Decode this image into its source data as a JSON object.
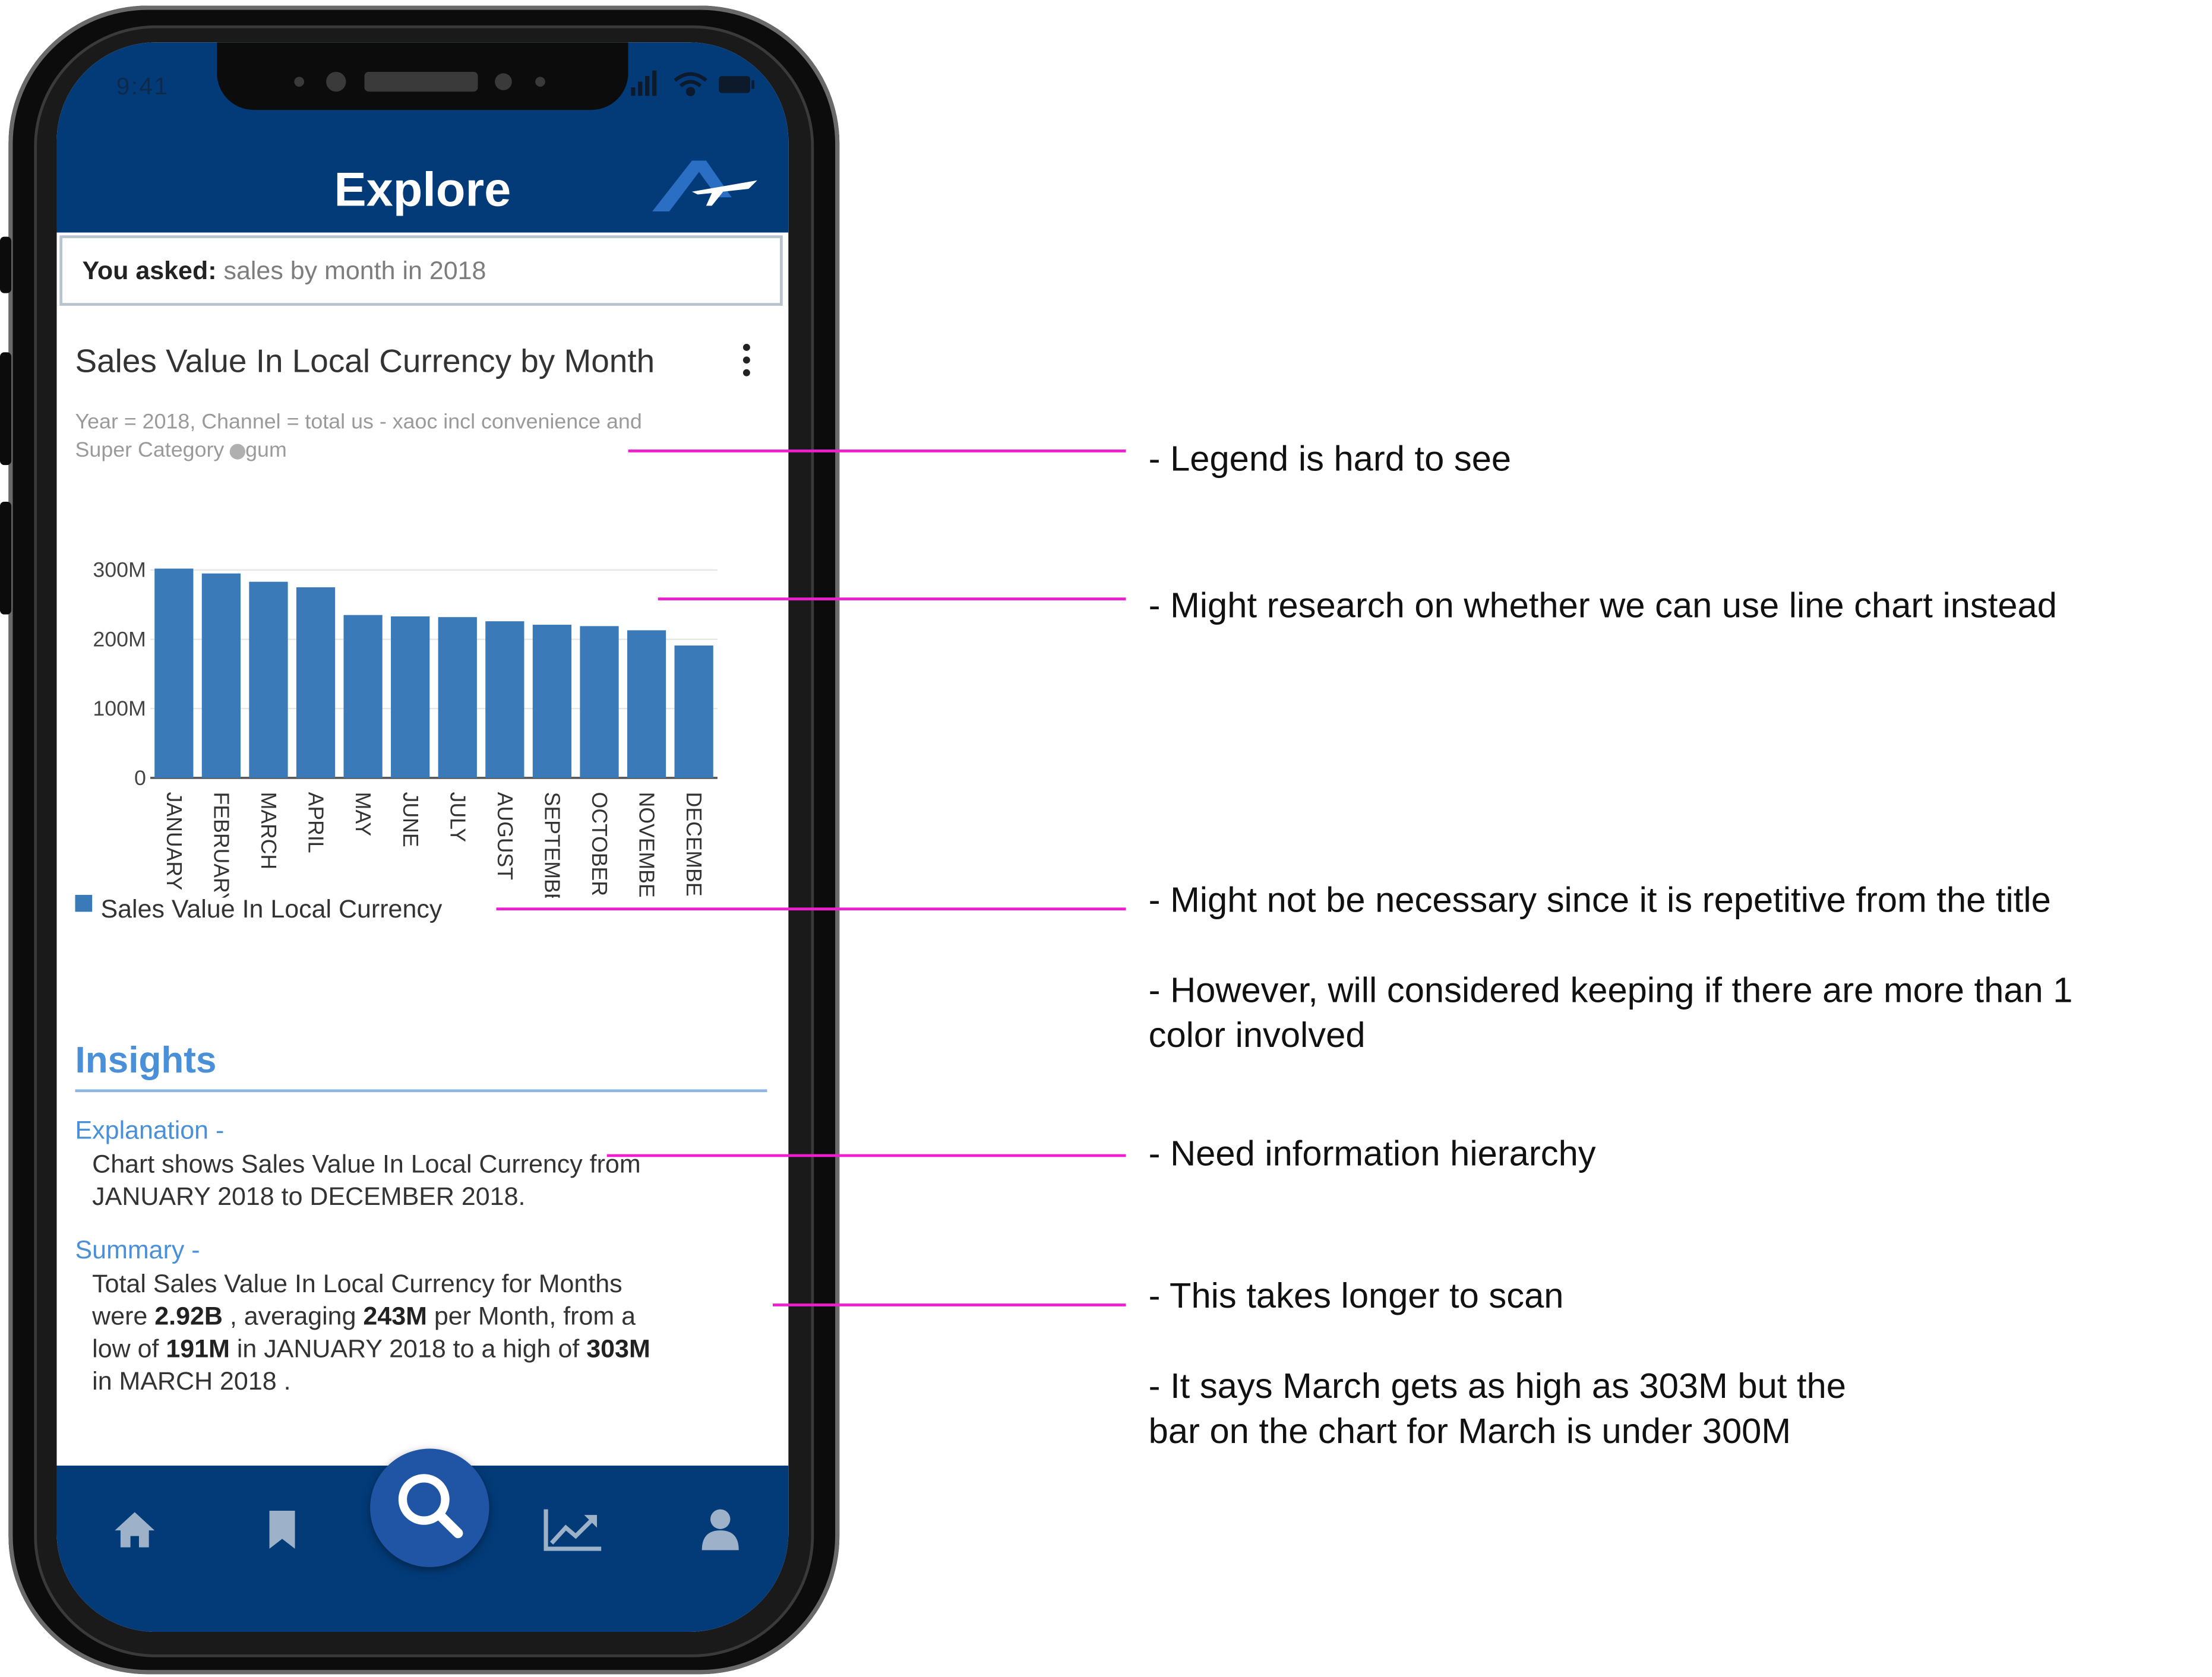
{
  "status_bar": {
    "time": "9:41"
  },
  "header": {
    "title": "Explore",
    "logo": "airline-logo-icon"
  },
  "query": {
    "prefix": "You asked:",
    "text": "sales by month in 2018"
  },
  "card": {
    "title": "Sales Value In Local Currency by Month",
    "filter_line1": "Year = 2018, Channel = total us - xaoc incl convenience and",
    "filter_line2_label": "Super Category",
    "filter_line2_value": "gum",
    "legend_label": "Sales Value In Local Currency"
  },
  "chart_data": {
    "type": "bar",
    "categories": [
      "JANUARY",
      "FEBRUARY",
      "MARCH",
      "APRIL",
      "MAY",
      "JUNE",
      "JULY",
      "AUGUST",
      "SEPTEMBER",
      "OCTOBER",
      "NOVEMBER",
      "DECEMBER"
    ],
    "series": [
      {
        "name": "Sales Value In Local Currency",
        "values": [
          302,
          295,
          283,
          275,
          235,
          233,
          232,
          226,
          221,
          219,
          213,
          191
        ]
      }
    ],
    "yticks": [
      "300M",
      "200M",
      "100M",
      "0"
    ],
    "ytick_values": [
      300,
      200,
      100,
      0
    ],
    "ylim": [
      0,
      305
    ],
    "grid": true,
    "color": "#3a7ab8"
  },
  "insights": {
    "heading": "Insights",
    "explanation_label": "Explanation -",
    "explanation_line1": "Chart shows Sales Value In Local Currency from",
    "explanation_line2": "JANUARY 2018 to DECEMBER 2018.",
    "summary_label": "Summary -",
    "summary_l1": "Total Sales Value In Local Currency for   Months",
    "summary_l2_a": "were ",
    "summary_total": "2.92B",
    "summary_l2_b": " , averaging ",
    "summary_avg": "243M",
    "summary_l2_c": " per Month, from a",
    "summary_l3_a": "low of ",
    "summary_low": "191M",
    "summary_l3_b": " in JANUARY 2018  to a high of ",
    "summary_high": "303M",
    "summary_l4": " in MARCH 2018 ."
  },
  "tabbar": {
    "items": [
      "home-icon",
      "bookmark-icon",
      "search-icon",
      "trending-chart-icon",
      "profile-icon"
    ]
  },
  "annotations": {
    "a1": "- Legend is hard to see",
    "a2": "- Might research on whether we can use line chart instead",
    "a3": "- Might not be necessary since it is repetitive from the title",
    "a4_l1": "- However, will considered keeping if there are more than 1",
    "a4_l2": "color involved",
    "a5": "- Need information hierarchy",
    "a6": "- This takes longer to scan",
    "a7_l1": "- It says March gets as high as 303M but the",
    "a7_l2": "bar on the chart for March is under 300M"
  },
  "colors": {
    "brand": "#033b78",
    "accent": "#4a90d9",
    "bar": "#3a7ab8",
    "annotation_line": "#ee1ed0"
  }
}
